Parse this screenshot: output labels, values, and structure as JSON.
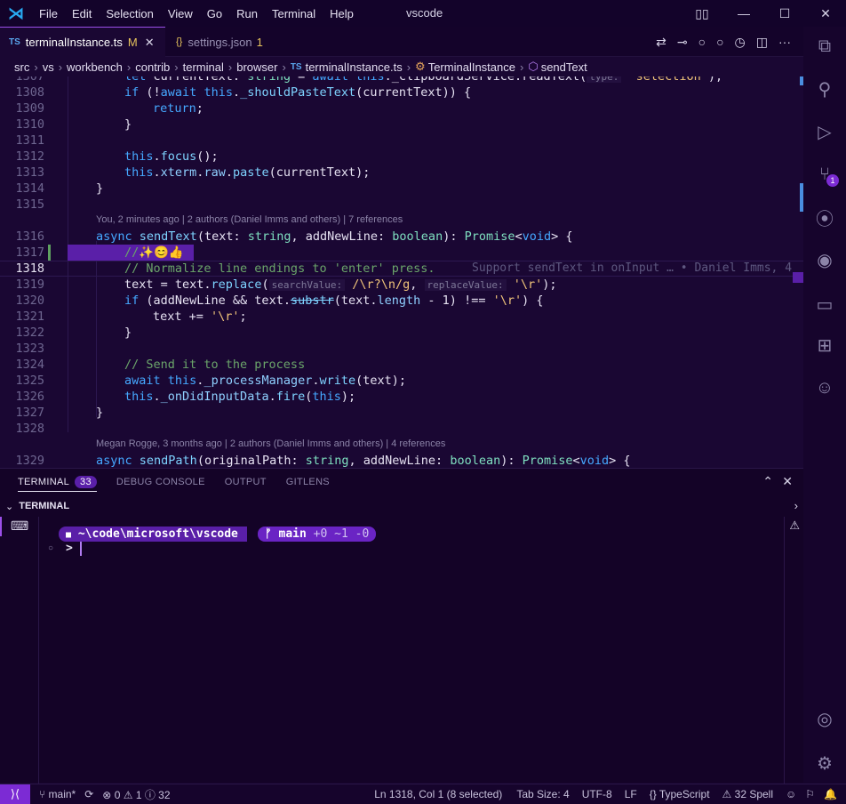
{
  "app": {
    "window_title": "vscode",
    "menu": [
      "File",
      "Edit",
      "Selection",
      "View",
      "Go",
      "Run",
      "Terminal",
      "Help"
    ]
  },
  "tabs": [
    {
      "icon": "TS",
      "label": "terminalInstance.ts",
      "status": "M"
    },
    {
      "icon": "{}",
      "label": "settings.json",
      "status": "1"
    }
  ],
  "breadcrumb": [
    "src",
    "vs",
    "workbench",
    "contrib",
    "terminal",
    "browser",
    "terminalInstance.ts",
    "TerminalInstance",
    "sendText"
  ],
  "editor": {
    "current_line": "1318",
    "lens_1": "You, 2 minutes ago | 2 authors (Daniel Imms and others) | 7 references",
    "lens_2": "Megan Rogge, 3 months ago | 2 authors (Daniel Imms and others) | 4 references",
    "blame": "Support sendText in onInput … • Daniel Imms, 4",
    "line_numbers": [
      "1307",
      "1308",
      "1309",
      "1310",
      "1311",
      "1312",
      "1313",
      "1314",
      "1315",
      "1316",
      "1317",
      "1318",
      "1319",
      "1320",
      "1321",
      "1322",
      "1323",
      "1324",
      "1325",
      "1326",
      "1327",
      "1328",
      "1329"
    ]
  },
  "panel": {
    "tabs": [
      "TERMINAL",
      "DEBUG CONSOLE",
      "OUTPUT",
      "GITLENS"
    ],
    "terminal_count": "33",
    "section_title": "TERMINAL",
    "prompt_path": "~\\code\\microsoft\\vscode",
    "prompt_branch": "main",
    "prompt_git": "+0 ~1 -0",
    "prompt_symbol": ">"
  },
  "status": {
    "branch": "main*",
    "errors": "0",
    "warnings": "1",
    "info": "32",
    "position": "Ln 1318, Col 1 (8 selected)",
    "tab_size": "Tab Size: 4",
    "encoding": "UTF-8",
    "eol": "LF",
    "language": "TypeScript",
    "spell": "32 Spell"
  },
  "activity_badge": "1",
  "colors": {
    "accent": "#7c2bd4",
    "background": "#1a0733"
  }
}
